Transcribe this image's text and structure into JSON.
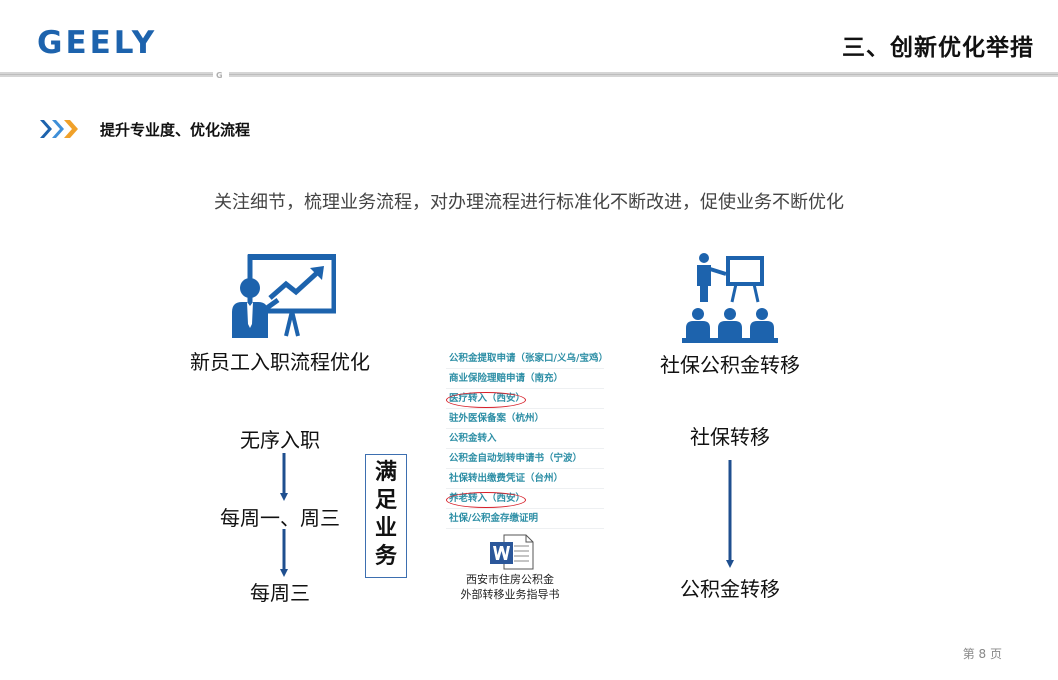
{
  "header": {
    "logo_text": "GEELY",
    "page_title": "三、创新优化举措"
  },
  "section": {
    "title": "提升专业度、优化流程"
  },
  "subtitle": "关注细节，梳理业务流程，对办理流程进行标准化不断改进，促使业务不断优化",
  "left_flow": {
    "title": "新员工入职流程优化",
    "steps": [
      "无序入职",
      "每周一、周三",
      "每周三"
    ]
  },
  "right_flow": {
    "title": "社保公积金转移",
    "steps": [
      "社保转移",
      "公积金转移"
    ]
  },
  "badge": {
    "chars": [
      "满",
      "足",
      "业",
      "务"
    ]
  },
  "doc_list": {
    "items": [
      "公积金提取申请（张家口/义乌/宝鸡）",
      "商业保险理赔申请（南充）",
      "医疗转入（西安）",
      "驻外医保备案（杭州）",
      "公积金转入",
      "公积金自动划转申请书（宁波）",
      "社保转出缴费凭证（台州）",
      "养老转入（西安）",
      "社保/公积金存缴证明"
    ]
  },
  "file": {
    "name_line1": "西安市住房公积金",
    "name_line2": "外部转移业务指导书"
  },
  "footer": {
    "page_label": "第 8 页"
  },
  "colors": {
    "brand_blue": "#1d63ad",
    "accent_orange": "#f0a12a",
    "arrow_blue": "#1f4f8f",
    "circle_red": "#d6202a"
  }
}
